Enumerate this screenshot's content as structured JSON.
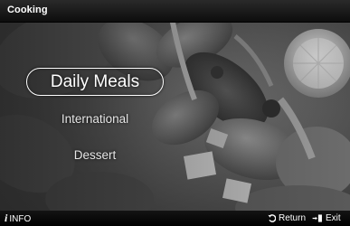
{
  "header": {
    "title": "Cooking"
  },
  "menu": {
    "items": [
      {
        "label": "Daily Meals",
        "selected": true
      },
      {
        "label": "International",
        "selected": false
      },
      {
        "label": "Dessert",
        "selected": false
      }
    ]
  },
  "footer": {
    "info_label": "INFO",
    "info_icon": "info-icon",
    "return_label": "Return",
    "return_icon": "return-arrow-icon",
    "exit_label": "Exit",
    "exit_icon": "exit-door-icon"
  },
  "background": {
    "icon": "food-salad-photo"
  }
}
